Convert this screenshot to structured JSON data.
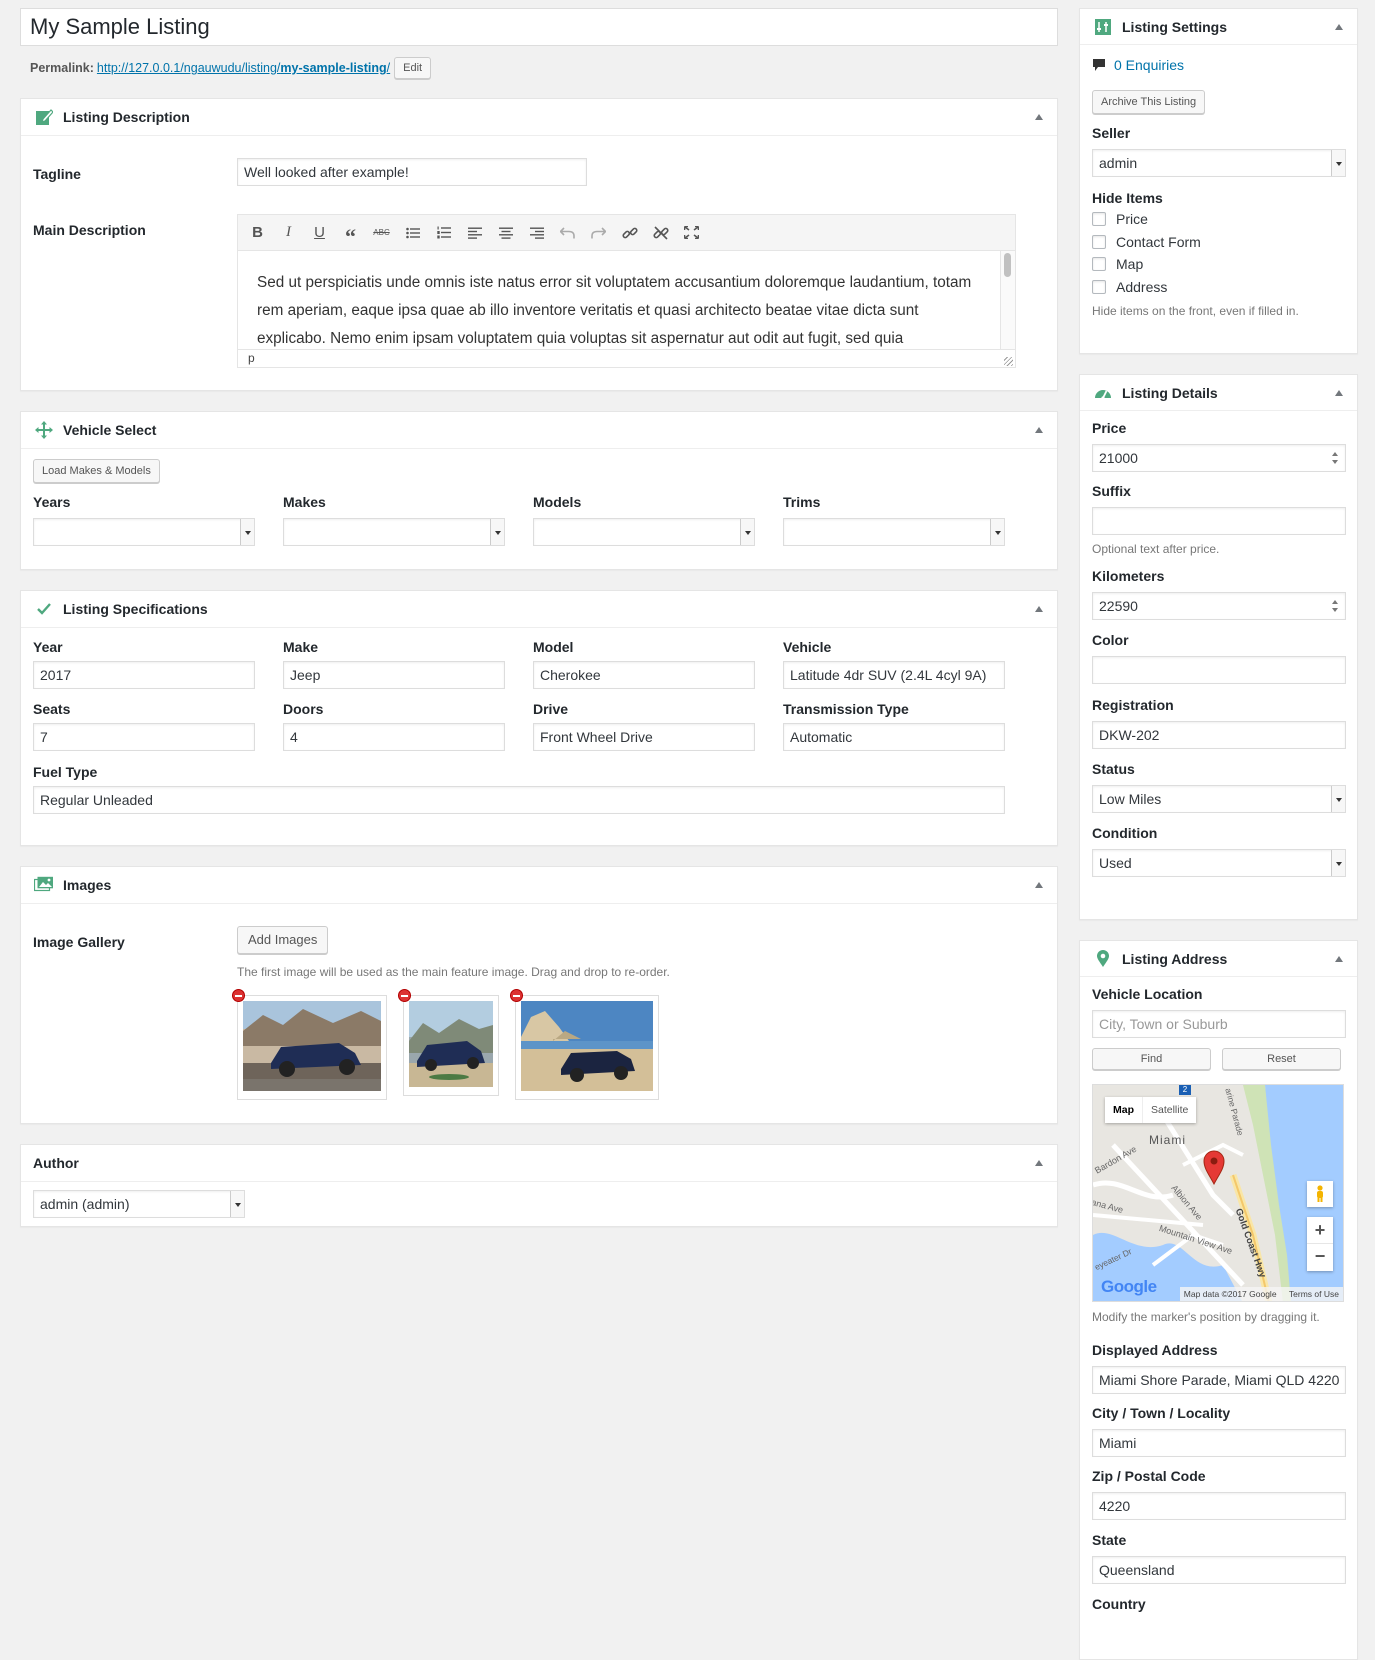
{
  "post": {
    "title": "My Sample Listing",
    "permalink_label": "Permalink:",
    "permalink_base": "http://127.0.0.1/ngauwudu/listing/",
    "permalink_slug": "my-sample-listing",
    "permalink_trailing": "/",
    "edit_label": "Edit"
  },
  "description": {
    "title": "Listing Description",
    "tagline_label": "Tagline",
    "tagline_value": "Well looked after example!",
    "main_label": "Main Description",
    "body": "Sed ut perspiciatis unde omnis iste natus error sit voluptatem accusantium doloremque laudantium, totam rem aperiam, eaque ipsa quae ab illo inventore veritatis et quasi architecto beatae vitae dicta sunt explicabo. Nemo enim ipsam voluptatem quia voluptas sit aspernatur aut odit aut fugit, sed quia",
    "status_path": "p",
    "toolbar": {
      "bold": "B",
      "italic": "I",
      "underline": "U",
      "quote": "“",
      "strike": "ABC"
    }
  },
  "vehicle_select": {
    "title": "Vehicle Select",
    "load_button": "Load Makes & Models",
    "years_label": "Years",
    "makes_label": "Makes",
    "models_label": "Models",
    "trims_label": "Trims"
  },
  "specs": {
    "title": "Listing Specifications",
    "year_label": "Year",
    "year": "2017",
    "make_label": "Make",
    "make": "Jeep",
    "model_label": "Model",
    "model": "Cherokee",
    "vehicle_label": "Vehicle",
    "vehicle": "Latitude 4dr SUV (2.4L 4cyl 9A)",
    "seats_label": "Seats",
    "seats": "7",
    "doors_label": "Doors",
    "doors": "4",
    "drive_label": "Drive",
    "drive": "Front Wheel Drive",
    "transmission_label": "Transmission Type",
    "transmission": "Automatic",
    "fuel_label": "Fuel Type",
    "fuel": "Regular Unleaded"
  },
  "images": {
    "title": "Images",
    "gallery_label": "Image Gallery",
    "add_button": "Add Images",
    "hint": "The first image will be used as the main feature image. Drag and drop to re-order."
  },
  "author": {
    "title": "Author",
    "value": "admin (admin)"
  },
  "settings": {
    "title": "Listing Settings",
    "enquiries": "0 Enquiries",
    "archive_button": "Archive This Listing",
    "seller_label": "Seller",
    "seller": "admin",
    "hide_label": "Hide Items",
    "hide_price": "Price",
    "hide_contact": "Contact Form",
    "hide_map": "Map",
    "hide_address": "Address",
    "hide_desc": "Hide items on the front, even if filled in."
  },
  "details": {
    "title": "Listing Details",
    "price_label": "Price",
    "price": "21000",
    "suffix_label": "Suffix",
    "suffix_desc": "Optional text after price.",
    "km_label": "Kilometers",
    "km": "22590",
    "color_label": "Color",
    "registration_label": "Registration",
    "registration": "DKW-202",
    "status_label": "Status",
    "status": "Low Miles",
    "condition_label": "Condition",
    "condition": "Used"
  },
  "address": {
    "title": "Listing Address",
    "location_label": "Vehicle Location",
    "location_placeholder": "City, Town or Suburb",
    "find_button": "Find",
    "reset_button": "Reset",
    "map": {
      "tab_map": "Map",
      "tab_satellite": "Satellite",
      "city": "Miami",
      "streets": [
        "Bardon Ave",
        "Albion Ave",
        "Mountain View Ave",
        "Gold Coast Hwy",
        "arine Parade",
        "ana Ave",
        "eyeater Dr"
      ],
      "route_badge": "2",
      "google": "Google",
      "attribution": "Map data ©2017 Google",
      "terms": "Terms of Use",
      "zoom_in": "+",
      "zoom_out": "−"
    },
    "map_desc": "Modify the marker's position by dragging it.",
    "displayed_label": "Displayed Address",
    "displayed": "Miami Shore Parade, Miami QLD 4220",
    "city_label": "City / Town / Locality",
    "city": "Miami",
    "zip_label": "Zip / Postal Code",
    "zip": "4220",
    "state_label": "State",
    "state": "Queensland",
    "country_label": "Country"
  },
  "colors": {
    "accent": "#4fa87f",
    "link": "#0073aa",
    "marker": "#e53935"
  }
}
